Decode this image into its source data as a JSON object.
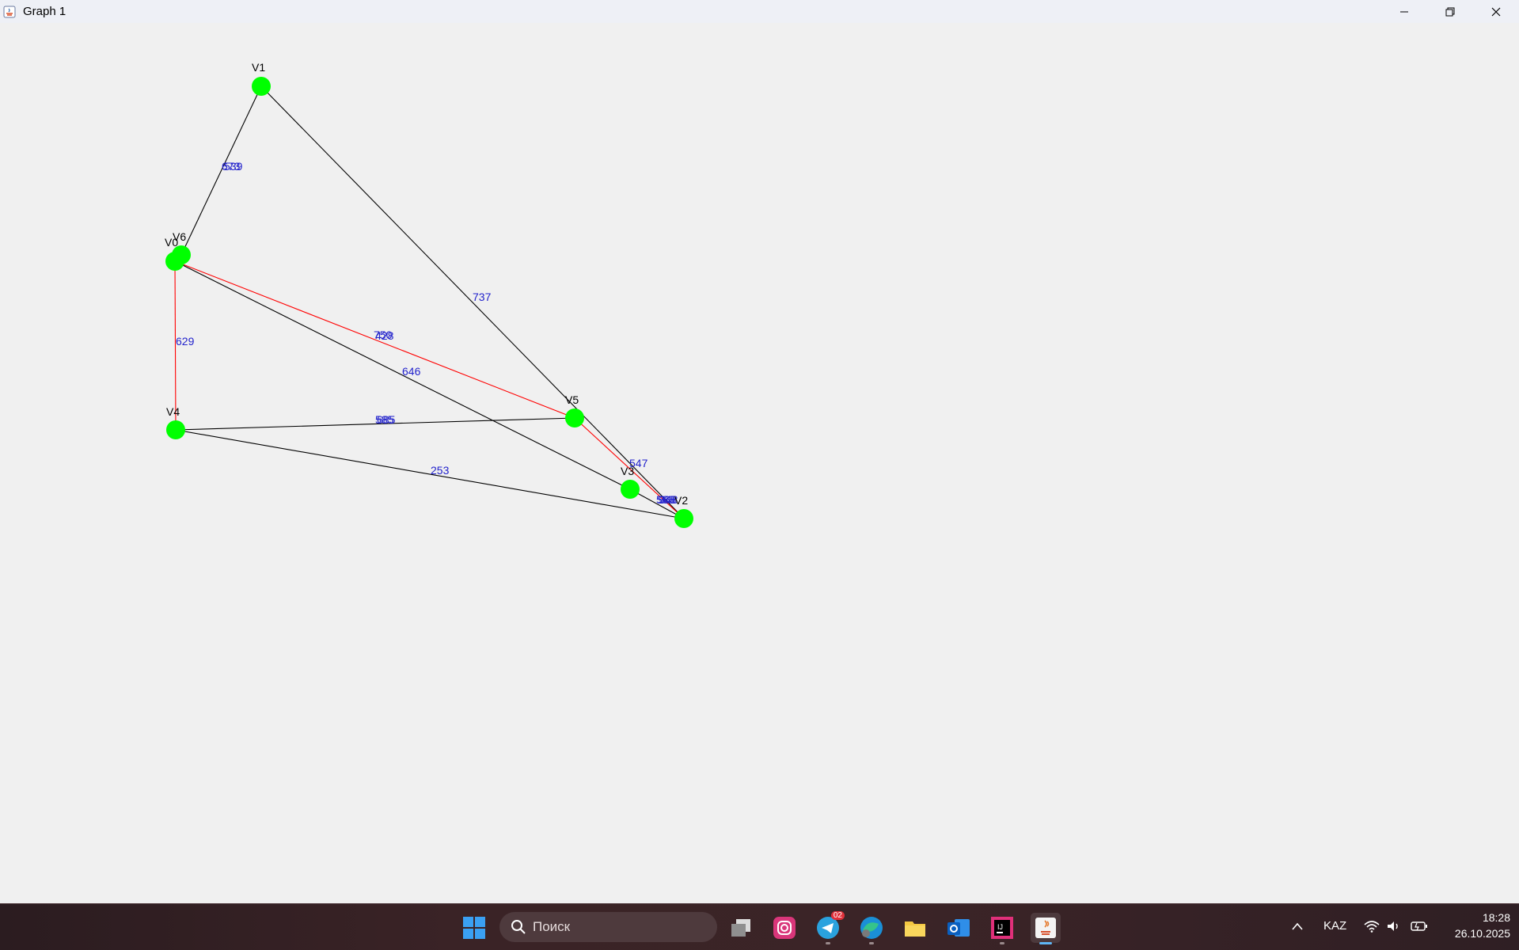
{
  "window": {
    "title": "Graph 1"
  },
  "graph": {
    "edge_weights": {
      "v1_v6": "539",
      "v1_v6_overlap": "673",
      "v1_v2": "737",
      "v0_v4": "629",
      "v0_v5_a": "750",
      "v0_v5_b": "428",
      "v0_v3": "646",
      "v4_v5_a": "585",
      "v4_v5_b": "685",
      "v4_v2": "253",
      "v5_v2": "547",
      "v3_v2_a": "588",
      "v3_v2_b": "968",
      "v3_v2_c": "348"
    },
    "vertices": {
      "v0": "V0",
      "v1": "V1",
      "v2": "V2",
      "v3": "V3",
      "v4": "V4",
      "v5": "V5",
      "v6": "V6"
    },
    "colors": {
      "vertex": "#00ff00",
      "edge": "#000000",
      "highlight_edge": "#ff0000",
      "weight_label": "#2222cc"
    }
  },
  "taskbar": {
    "search_placeholder": "Поиск",
    "telegram_badge": "02",
    "language": "KAZ",
    "time": "18:28",
    "date": "26.10.2025"
  }
}
